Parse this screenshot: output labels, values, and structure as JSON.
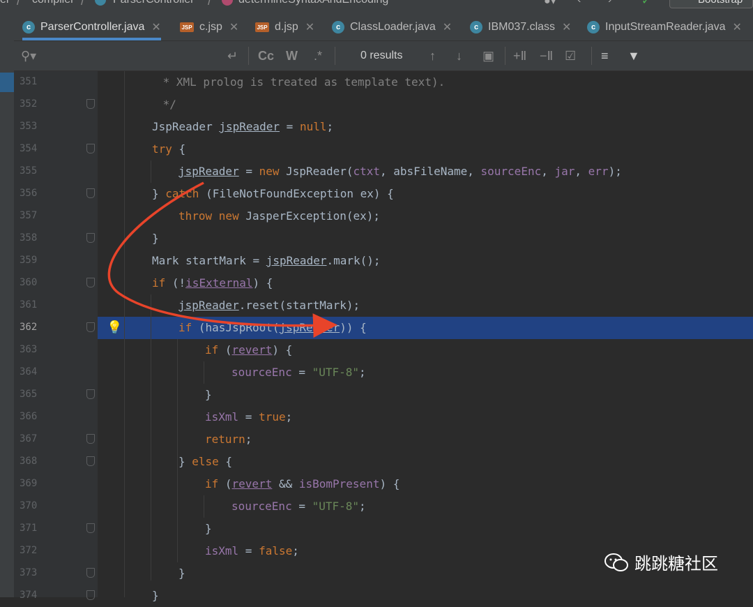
{
  "breadcrumb": {
    "items": [
      "er",
      "compiler",
      "ParserController",
      "determineSyntaxAndEncoding"
    ],
    "bootstrap": "Bootstrap"
  },
  "tabs": [
    {
      "label": "ParserController.java",
      "icon": "class-icon",
      "active": true
    },
    {
      "label": "c.jsp",
      "icon": "jsp-icon"
    },
    {
      "label": "d.jsp",
      "icon": "jsp-icon"
    },
    {
      "label": "ClassLoader.java",
      "icon": "class-icon"
    },
    {
      "label": "IBM037.class",
      "icon": "class-icon"
    },
    {
      "label": "InputStreamReader.java",
      "icon": "class-icon"
    }
  ],
  "search": {
    "results": "0 results",
    "case_label": "Cc",
    "word_label": "W",
    "regex_label": ".*"
  },
  "lines": [
    {
      "no": "351",
      "html": "<span class='cmt'> * XML prolog is treated as template text).</span>",
      "indent": 0
    },
    {
      "no": "352",
      "html": "<span class='cmt'> */</span>",
      "indent": 0
    },
    {
      "no": "353",
      "html": "JspReader <span class='u'>jspReader</span> = <span class='kw'>null</span>;",
      "indent": 0
    },
    {
      "no": "354",
      "html": "<span class='kw'>try</span> {",
      "indent": 0
    },
    {
      "no": "355",
      "html": "<span class='u'>jspReader</span> = <span class='kw'>new</span> JspReader(<span class='fld'>ctxt</span>, absFileName, <span class='fld'>sourceEnc</span>, <span class='fld'>jar</span>, <span class='fld'>err</span>);",
      "indent": 1
    },
    {
      "no": "356",
      "html": "} <span class='kw'>catch</span> (FileNotFoundException ex) {",
      "indent": 0
    },
    {
      "no": "357",
      "html": "<span class='kw'>throw new</span> JasperException(ex);",
      "indent": 1
    },
    {
      "no": "358",
      "html": "}",
      "indent": 0
    },
    {
      "no": "359",
      "html": "Mark startMark = <span class='u'>jspReader</span>.mark();",
      "indent": 0
    },
    {
      "no": "360",
      "html": "<span class='kw'>if</span> (!<span class='fld u'>isExternal</span>) {",
      "indent": 0
    },
    {
      "no": "361",
      "html": "<span class='u'>jspReader</span>.reset(startMark);",
      "indent": 1
    },
    {
      "no": "362",
      "html": "<span class='kw'>if</span> (hasJspRoot(<span class='u'>jspReader</span>)) {",
      "indent": 1
    },
    {
      "no": "363",
      "html": "<span class='kw'>if</span> (<span class='fld u'>revert</span>) {",
      "indent": 2
    },
    {
      "no": "364",
      "html": "<span class='fld'>sourceEnc</span> = <span class='str'>\"UTF-8\"</span>;",
      "indent": 3
    },
    {
      "no": "365",
      "html": "}",
      "indent": 2
    },
    {
      "no": "366",
      "html": "<span class='fld'>isXml</span> = <span class='kw'>true</span>;",
      "indent": 2
    },
    {
      "no": "367",
      "html": "<span class='kw'>return</span>;",
      "indent": 2
    },
    {
      "no": "368",
      "html": "} <span class='kw'>else</span> {",
      "indent": 1
    },
    {
      "no": "369",
      "html": "<span class='kw'>if</span> (<span class='fld u'>revert</span> &amp;&amp; <span class='fld'>isBomPresent</span>) {",
      "indent": 2
    },
    {
      "no": "370",
      "html": "<span class='fld'>sourceEnc</span> = <span class='str'>\"UTF-8\"</span>;",
      "indent": 3
    },
    {
      "no": "371",
      "html": "}",
      "indent": 2
    },
    {
      "no": "372",
      "html": "<span class='fld'>isXml</span> = <span class='kw'>false</span>;",
      "indent": 2
    },
    {
      "no": "373",
      "html": "}",
      "indent": 1
    },
    {
      "no": "374",
      "html": "}",
      "indent": 0
    }
  ],
  "watermark": "跳跳糖社区"
}
